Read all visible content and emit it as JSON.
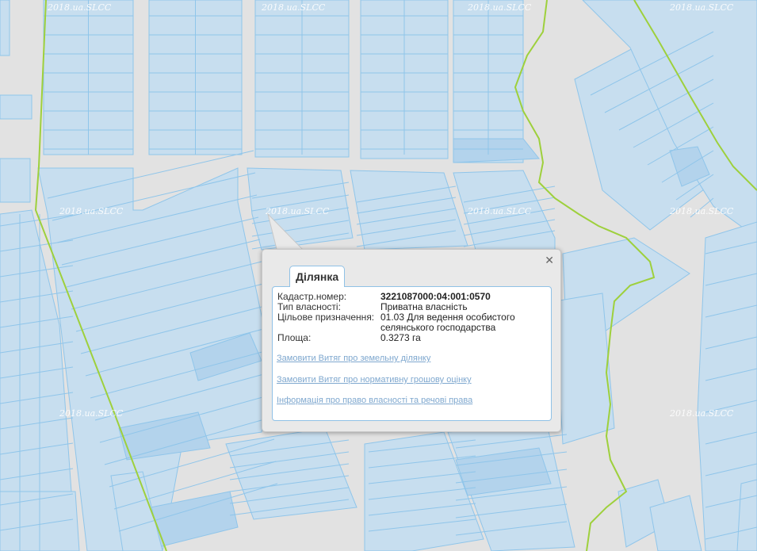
{
  "map": {
    "watermark": "2018.ua.SLCC",
    "colors": {
      "background": "#e2e2e2",
      "parcel_fill": "#c7deef",
      "parcel_fill_dark": "#b3d3ec",
      "parcel_stroke": "#8fc5ea",
      "boundary_green": "#9ed03c"
    }
  },
  "popup": {
    "close_glyph": "✕",
    "tab_title": "Ділянка",
    "fields": [
      {
        "label": "Кадастр.номер:",
        "value": "3221087000:04:001:0570"
      },
      {
        "label": "Тип власності:",
        "value": "Приватна власність"
      },
      {
        "label": "Цільове призначення:",
        "value": "01.03 Для ведення особистого селянського господарства"
      },
      {
        "label": "Площа:",
        "value": "0.3273 га"
      }
    ],
    "links": [
      "Замовити Витяг про земельну ділянку",
      "Замовити Витяг про нормативну грошову оцінку",
      "Інформація про право власності та речові права"
    ]
  }
}
